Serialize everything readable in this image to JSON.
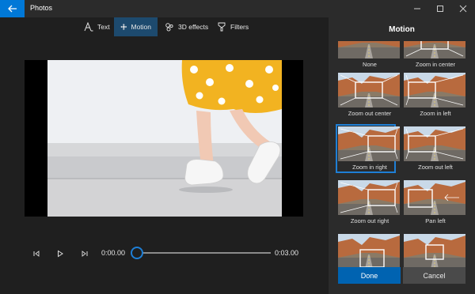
{
  "app": {
    "title": "Photos"
  },
  "toolbar": {
    "items": [
      {
        "label": "Text",
        "icon": "text-icon"
      },
      {
        "label": "Motion",
        "icon": "motion-icon",
        "active": true
      },
      {
        "label": "3D effects",
        "icon": "3d-effects-icon"
      },
      {
        "label": "Filters",
        "icon": "filters-icon"
      }
    ]
  },
  "playback": {
    "current_time": "0:00.00",
    "end_time": "0:03.00",
    "progress": 0
  },
  "panel": {
    "title": "Motion",
    "items": [
      {
        "label": "None"
      },
      {
        "label": "Zoom in center"
      },
      {
        "label": "Zoom out center"
      },
      {
        "label": "Zoom in left"
      },
      {
        "label": "Zoom in right",
        "selected": true
      },
      {
        "label": "Zoom out left"
      },
      {
        "label": "Zoom out right"
      },
      {
        "label": "Pan left"
      },
      {
        "label": ""
      },
      {
        "label": ""
      }
    ],
    "done_label": "Done",
    "cancel_label": "Cancel"
  },
  "colors": {
    "accent": "#0078d7",
    "selection": "#1e7fd6",
    "background": "#1f1f1f",
    "panel": "#2b2b2b"
  }
}
